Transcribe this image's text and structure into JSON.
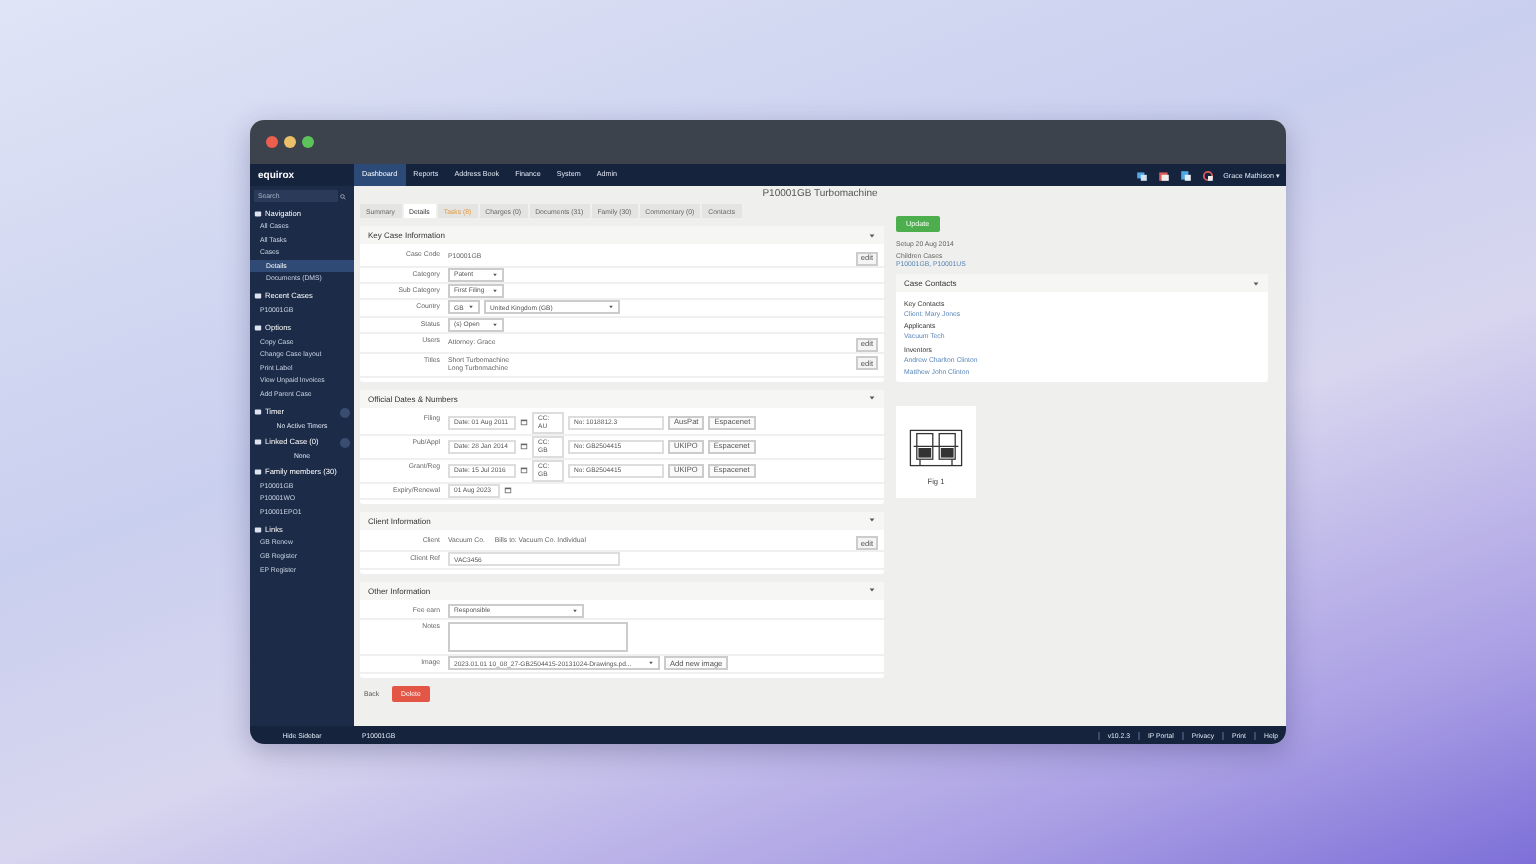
{
  "nav": {
    "logo": "equirox",
    "tabs": [
      {
        "label": "Dashboard",
        "selected": true
      },
      {
        "label": "Reports",
        "selected": false
      },
      {
        "label": "Address Book",
        "selected": false
      },
      {
        "label": "Finance",
        "selected": false
      },
      {
        "label": "System",
        "selected": false
      },
      {
        "label": "Admin",
        "selected": false
      }
    ],
    "user": "Grace Mathison ▾"
  },
  "sidebar": {
    "search": {
      "placeholder": "Search"
    },
    "sections": [
      {
        "title": "Navigation",
        "add": false,
        "items": [
          {
            "label": "All Cases",
            "selected": false
          },
          {
            "label": "All Tasks",
            "selected": false
          },
          {
            "label": "Cases",
            "selected": false,
            "children": [
              {
                "label": "Details",
                "selected": true
              },
              {
                "label": "Documents (DMS)",
                "selected": false
              }
            ]
          }
        ]
      },
      {
        "title": "Recent Cases",
        "add": false,
        "items": [
          {
            "label": "P10001GB",
            "selected": false
          }
        ]
      },
      {
        "title": "Options",
        "add": false,
        "items": [
          {
            "label": "Copy Case",
            "selected": false
          },
          {
            "label": "Change Case layout",
            "selected": false
          },
          {
            "label": "Print Label",
            "selected": false
          },
          {
            "label": "View Unpaid Invoices",
            "selected": false
          },
          {
            "label": "Add Parent Case",
            "selected": false
          }
        ]
      },
      {
        "title": "Timer",
        "add": true,
        "note": "No Active Timers"
      },
      {
        "title": "Linked Case (0)",
        "add": true,
        "note": "None"
      },
      {
        "title": "Family members (30)",
        "add": false,
        "items": [
          {
            "label": "P10001GB",
            "selected": false
          },
          {
            "label": "P10001WO",
            "selected": false
          },
          {
            "label": "P10001EPO1",
            "selected": false
          }
        ]
      },
      {
        "title": "Links",
        "add": false,
        "items": [
          {
            "label": "GB Renew",
            "selected": false
          },
          {
            "label": "GB Register",
            "selected": false
          },
          {
            "label": "EP Register",
            "selected": false
          }
        ]
      }
    ]
  },
  "page_title": "P10001GB Turbomachine",
  "tabs": [
    {
      "label": "Summary",
      "selected": false,
      "alert": false
    },
    {
      "label": "Details",
      "selected": true,
      "alert": false
    },
    {
      "label": "Tasks (8)",
      "selected": false,
      "alert": true
    },
    {
      "label": "Charges (0)",
      "selected": false,
      "alert": false
    },
    {
      "label": "Documents (31)",
      "selected": false,
      "alert": false
    },
    {
      "label": "Family (30)",
      "selected": false,
      "alert": false
    },
    {
      "label": "Commentary (0)",
      "selected": false,
      "alert": false
    },
    {
      "label": "Contacts",
      "selected": false,
      "alert": false
    }
  ],
  "key_info": {
    "title": "Key Case Information",
    "rows": [
      {
        "kind": "text",
        "label": "Case Code",
        "value": "P10001GB",
        "action": "edit"
      },
      {
        "kind": "select",
        "label": "Category",
        "value": "Patent"
      },
      {
        "kind": "select",
        "label": "Sub Category",
        "value": "First Filing"
      },
      {
        "kind": "country",
        "label": "Country",
        "code": "GB",
        "value": "United Kingdom (GB)"
      },
      {
        "kind": "select",
        "label": "Status",
        "value": "(s) Open"
      },
      {
        "kind": "text",
        "label": "Users",
        "value": "Attorney: Grace",
        "action": "edit"
      },
      {
        "kind": "titles",
        "label": "Titles",
        "lines": [
          {
            "prefix": "Short",
            "value": "Turbomachine"
          },
          {
            "prefix": "Long",
            "value": "Turbomachine"
          }
        ],
        "action": "edit"
      }
    ]
  },
  "dates": {
    "title": "Official Dates & Numbers",
    "rows": [
      {
        "kind": "full",
        "label": "Filing",
        "date": "Date: 01 Aug 2011",
        "cc": "CC: AU",
        "no": "No: 1018812.3",
        "buttons": [
          "AusPat",
          "Espacenet"
        ]
      },
      {
        "kind": "full",
        "label": "Pub/Appl",
        "date": "Date: 28 Jan 2014",
        "cc": "CC: GB",
        "no": "No: GB2504415",
        "buttons": [
          "UKIPO",
          "Espacenet"
        ]
      },
      {
        "kind": "full",
        "label": "Grant/Reg",
        "date": "Date: 15 Jul 2016",
        "cc": "CC: GB",
        "no": "No: GB2504415",
        "buttons": [
          "UKIPO",
          "Espacenet"
        ]
      },
      {
        "kind": "date",
        "label": "Expiry/Renewal",
        "date": "01 Aug 2023"
      }
    ]
  },
  "client": {
    "title": "Client Information",
    "client_label": "Client",
    "client": "Vacuum Co.",
    "bills_to": "Bills to: Vacuum Co. Individual",
    "action": "edit",
    "ref_label": "Client Ref",
    "ref": "VAC3456"
  },
  "other": {
    "title": "Other Information",
    "fee_label": "Fee earn",
    "fee": "Responsible",
    "notes_label": "Notes",
    "image_label": "Image",
    "image": "2023.01.01 10_08_27-GB2504415-20131024-Drawings.pd...",
    "add_image": "Add new image"
  },
  "buttons": {
    "back": "Back",
    "delete": "Delete"
  },
  "side": {
    "update": "Update",
    "setup": "Setup 20 Aug 2014",
    "children_label": "Children Cases",
    "children": "P10001GB, P10001US",
    "contacts": {
      "title": "Case Contacts",
      "groups": [
        {
          "heading": "Key Contacts",
          "names": [
            "Client: Mary Jones"
          ]
        },
        {
          "heading": "Applicants",
          "names": [
            "Vacuum Tech"
          ]
        },
        {
          "heading": "Inventors",
          "names": [
            "Andrew Charlton Clinton",
            "Matthew John Clinton"
          ]
        }
      ]
    },
    "figure_caption": "Fig 1"
  },
  "status_bar": {
    "left": "Hide Sidebar",
    "case": "P10001GB",
    "items": [
      "v10.2.3",
      "IP Portal",
      "Privacy",
      "Print",
      "Help"
    ]
  }
}
